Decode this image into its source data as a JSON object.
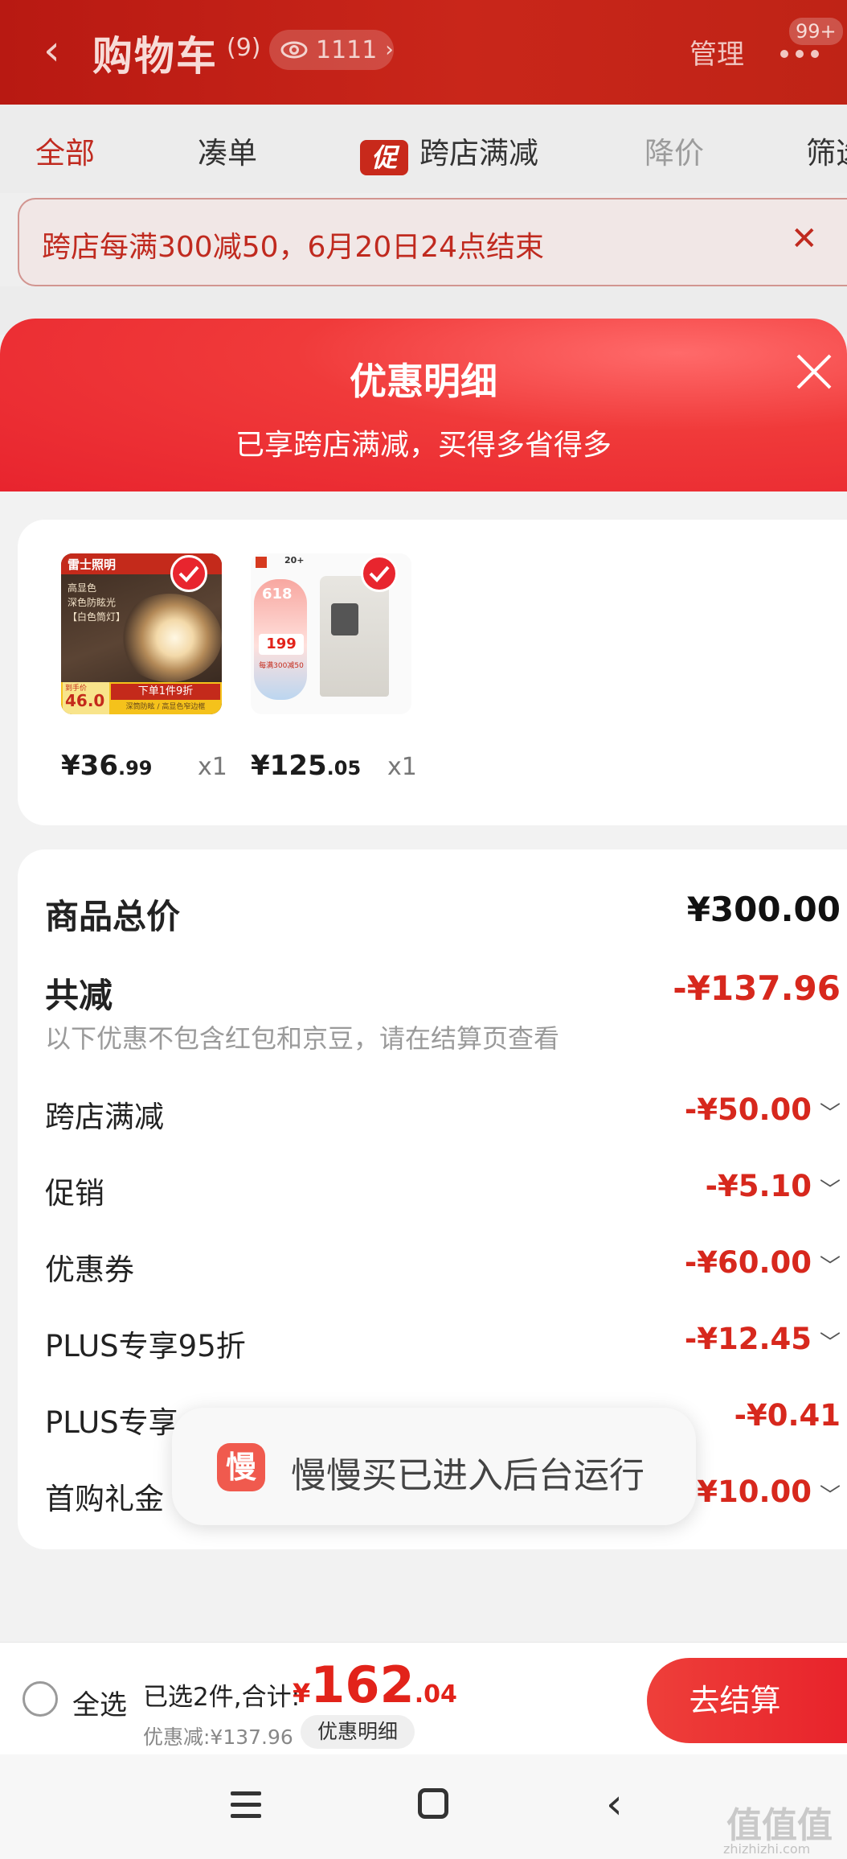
{
  "header": {
    "back_glyph": "‹",
    "title": "购物车",
    "count": "(9)",
    "views": "1111",
    "manage": "管理",
    "badge": "99+"
  },
  "tabs": [
    {
      "label": "全部"
    },
    {
      "label": "凑单"
    },
    {
      "label": "跨店满减",
      "tag": "促"
    },
    {
      "label": "降价"
    },
    {
      "label": "筛选"
    }
  ],
  "notice": {
    "text": "跨店每满300减50，6月20日24点结束",
    "close": "✕"
  },
  "sheet": {
    "title": "优惠明细",
    "subtitle": "已享跨店满减，买得多省得多",
    "products": [
      {
        "price_int": "¥36",
        "price_dec": ".99",
        "qty": "x1",
        "img": {
          "brand": "雷士照明",
          "lines": [
            "高显色",
            "深色防眩光",
            "【白色筒灯】"
          ],
          "bottom": "下单1件9折",
          "sub": "深筒防眩 / 高显色窄边框",
          "price_label": "到手价",
          "price": "46.0"
        }
      },
      {
        "price_int": "¥125",
        "price_dec": ".05",
        "qty": "x1",
        "img": {
          "top_tag": "618",
          "price": "199",
          "promo": "每满300减50",
          "badge": "20+"
        }
      }
    ],
    "summary": {
      "total_label": "商品总价",
      "total_value": "¥300.00",
      "reduce_label": "共减",
      "reduce_value": "-¥137.96",
      "reduce_note": "以下优惠不包含红包和京豆，请在结算页查看",
      "items": [
        {
          "label": "跨店满减",
          "value": "-¥50.00",
          "chevron": true
        },
        {
          "label": "促销",
          "value": "-¥5.10",
          "chevron": true
        },
        {
          "label": "优惠券",
          "value": "-¥60.00",
          "chevron": true
        },
        {
          "label": "PLUS专享95折",
          "value": "-¥12.45",
          "chevron": true
        },
        {
          "label": "PLUS专享",
          "value": "-¥0.41",
          "chevron": false
        },
        {
          "label": "首购礼金",
          "value": "-¥10.00",
          "chevron": true
        }
      ]
    }
  },
  "toast": {
    "icon_char": "慢",
    "text": "慢慢买已进入后台运行"
  },
  "bottom": {
    "select_all": "全选",
    "selected_info": "已选2件,合计:",
    "total_symbol": "¥",
    "total_int": "162",
    "total_dec": ".04",
    "saved": "优惠减:¥137.96",
    "detail": "优惠明细",
    "checkout": "去结算"
  },
  "watermark": {
    "main": "值值值",
    "sub": "zhizhizhi.com"
  },
  "colors": {
    "brand_red": "#e8252e",
    "price_red": "#d7281d"
  }
}
